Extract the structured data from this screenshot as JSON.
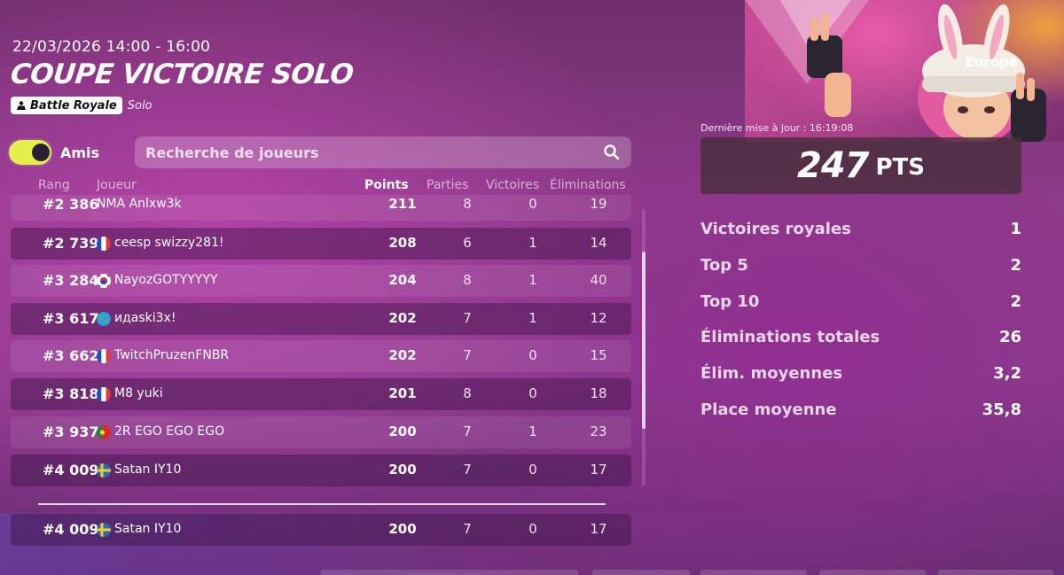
{
  "header": {
    "date": "22/03/2026 14:00 - 16:00",
    "title": "COUPE VICTOIRE SOLO",
    "mode_badge": "Battle Royale",
    "mode_sub": "Solo"
  },
  "friends_toggle": {
    "label": "Amis",
    "on": true
  },
  "search": {
    "placeholder": "Recherche de joueurs"
  },
  "columns": {
    "rank": "Rang",
    "player": "Joueur",
    "points": "Points",
    "games": "Parties",
    "wins": "Victoires",
    "elims": "Éliminations"
  },
  "rows": [
    {
      "rank": "#2 386",
      "flag": "",
      "name": "NMA Anlxw3k",
      "points": "211",
      "games": "8",
      "wins": "0",
      "elims": "19"
    },
    {
      "rank": "#2 739",
      "flag": "fr",
      "name": "ceesp swizzy281!",
      "points": "208",
      "games": "6",
      "wins": "1",
      "elims": "14"
    },
    {
      "rank": "#3 284",
      "flag": "kr",
      "name": "NayozGOTYYYYY",
      "points": "204",
      "games": "8",
      "wins": "1",
      "elims": "40"
    },
    {
      "rank": "#3 617",
      "flag": "globe",
      "name": "идаski3x!",
      "points": "202",
      "games": "7",
      "wins": "1",
      "elims": "12"
    },
    {
      "rank": "#3 662",
      "flag": "fr",
      "name": "TwitchPruzenFNBR",
      "points": "202",
      "games": "7",
      "wins": "0",
      "elims": "15"
    },
    {
      "rank": "#3 818",
      "flag": "fr",
      "name": "M8 yuki",
      "points": "201",
      "games": "8",
      "wins": "0",
      "elims": "18"
    },
    {
      "rank": "#3 937",
      "flag": "pt",
      "name": "2R EGO EGO EGO",
      "points": "200",
      "games": "7",
      "wins": "1",
      "elims": "23"
    },
    {
      "rank": "#4 009",
      "flag": "se",
      "name": "Satan IY10",
      "points": "200",
      "games": "7",
      "wins": "0",
      "elims": "17"
    }
  ],
  "own_row": {
    "rank": "#4 009",
    "flag": "se",
    "name": "Satan IY10",
    "points": "200",
    "games": "7",
    "wins": "0",
    "elims": "17"
  },
  "panel": {
    "region": "Europe",
    "updated": "Dernière mise à jour : 16:19:08",
    "points_value": "247",
    "points_unit": "PTS",
    "stats": [
      {
        "label": "Victoires royales",
        "value": "1"
      },
      {
        "label": "Top 5",
        "value": "2"
      },
      {
        "label": "Top 10",
        "value": "2"
      },
      {
        "label": "Éliminations totales",
        "value": "26"
      },
      {
        "label": "Élim. moyennes",
        "value": "3,2"
      },
      {
        "label": "Place moyenne",
        "value": "35,8"
      }
    ]
  },
  "colors": {
    "toggle_on": "#e4ef4a",
    "bg": "#8c3b89"
  },
  "icons": {
    "search": "search-icon",
    "mode": "battle-royale-icon"
  }
}
